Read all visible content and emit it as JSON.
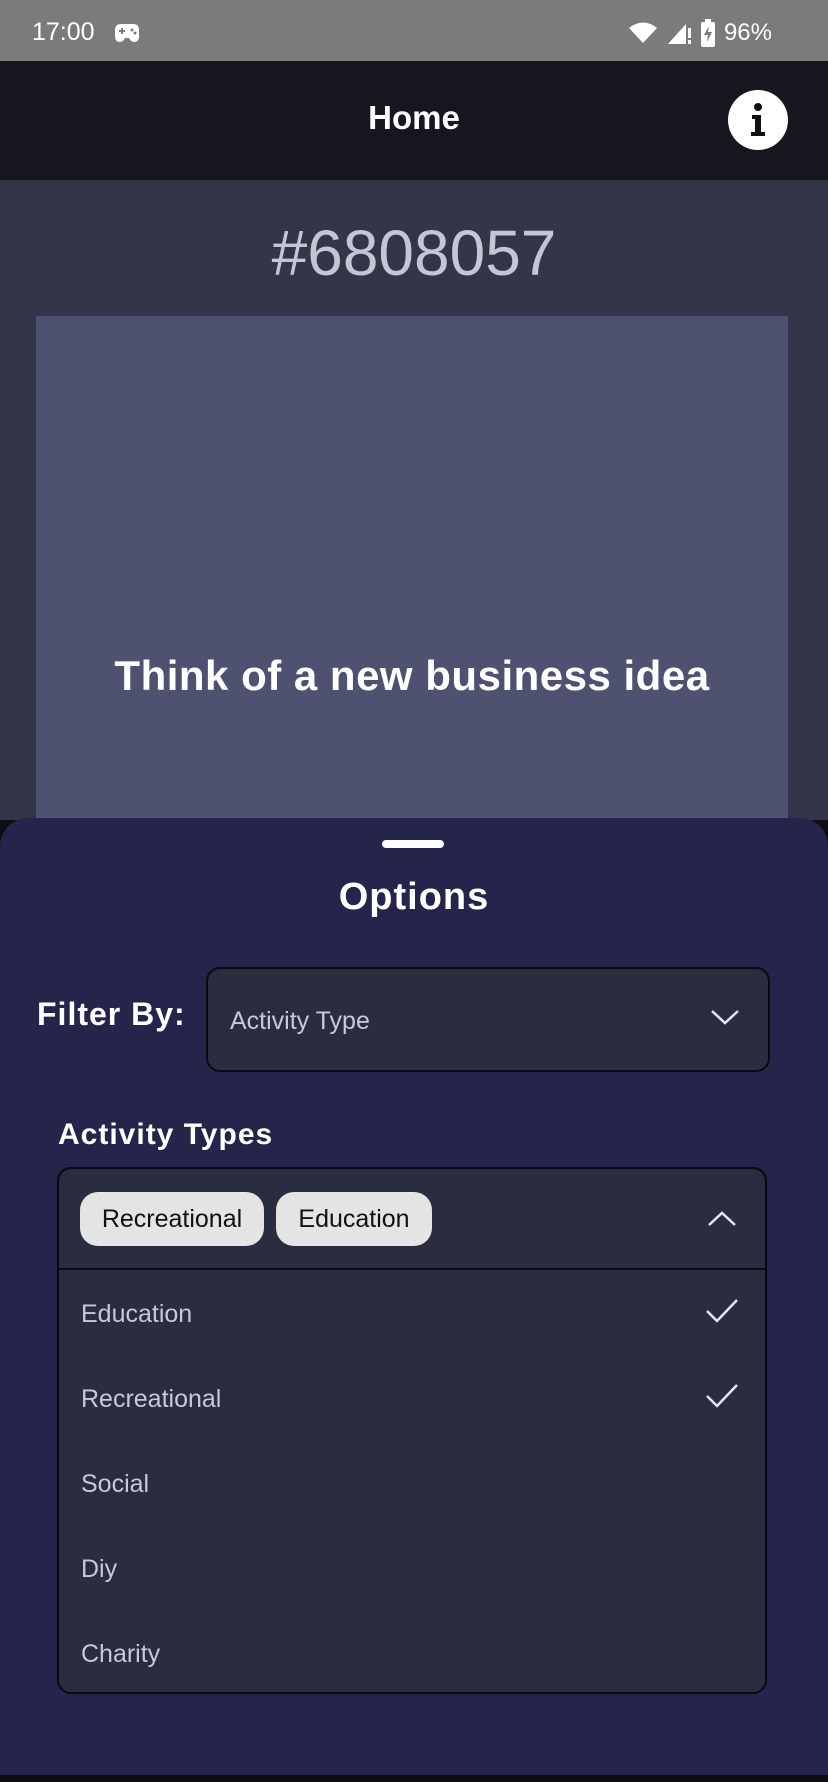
{
  "status_bar": {
    "time": "17:00",
    "app_icon": "game-controller-icon",
    "wifi_icon": "wifi-icon",
    "signal_icon": "cell-signal-icon",
    "battery_icon": "battery-charging-icon",
    "battery_percent": "96%"
  },
  "app_bar": {
    "title": "Home",
    "info_icon": "info-icon"
  },
  "activity": {
    "key": "#6808057",
    "text": "Think of a new business idea"
  },
  "sheet": {
    "title": "Options",
    "filter_label": "Filter By:",
    "filter_value": "Activity Type",
    "types_heading": "Activity Types",
    "selected_chips": [
      "Recreational",
      "Education"
    ],
    "options": [
      {
        "label": "Education",
        "checked": true
      },
      {
        "label": "Recreational",
        "checked": true
      },
      {
        "label": "Social",
        "checked": false
      },
      {
        "label": "Diy",
        "checked": false
      },
      {
        "label": "Charity",
        "checked": false
      }
    ]
  },
  "colors": {
    "app_bar": "#17161f",
    "main_bg": "#353549",
    "card_bg": "#4f5170",
    "sheet_bg": "#25254b",
    "field_bg": "#2a2c40",
    "chip_bg": "#e4e4e4"
  }
}
